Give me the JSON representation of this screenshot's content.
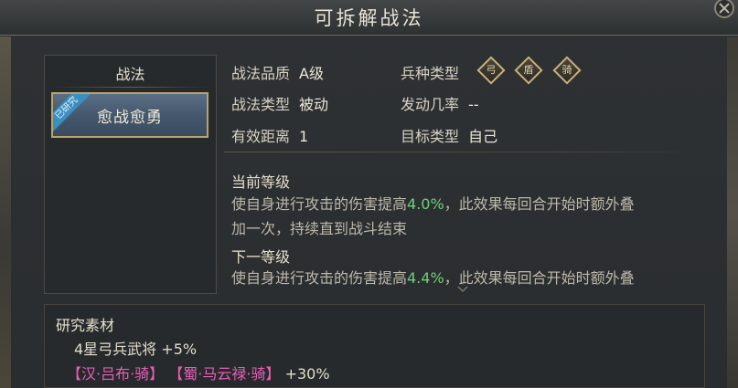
{
  "header": {
    "title": "可拆解战法"
  },
  "tactic_list": {
    "header": "战法",
    "items": [
      {
        "name": "愈战愈勇",
        "badge": "已研究"
      }
    ]
  },
  "attributes": {
    "quality": {
      "label": "战法品质",
      "value": "A级"
    },
    "type": {
      "label": "战法类型",
      "value": "被动"
    },
    "range": {
      "label": "有效距离",
      "value": "1"
    },
    "troops": {
      "label": "兵种类型",
      "icons": [
        "bow-troop-icon",
        "shield-troop-icon",
        "cavalry-troop-icon"
      ]
    },
    "trigger": {
      "label": "发动几率",
      "value": "--"
    },
    "target": {
      "label": "目标类型",
      "value": "自己"
    }
  },
  "current_level": {
    "title": "当前等级",
    "line1_pre": "使自身进行攻击的伤害提高",
    "line1_value": "4.0%",
    "line1_post": "，此效果每回合开始时额外叠",
    "line2": "加一次，持续直到战斗结束"
  },
  "next_level": {
    "title": "下一等级",
    "line1_pre": "使自身进行攻击的伤害提高",
    "line1_value": "4.4%",
    "line1_post": "，此效果每回合开始时额外叠"
  },
  "materials": {
    "title": "研究素材",
    "line1": {
      "text": "4星弓兵武将",
      "bonus": "+5%"
    },
    "line2": {
      "hero1": "【汉·吕布·骑】",
      "hero2": "【蜀·马云禄·骑】",
      "bonus": "+30%"
    }
  },
  "colors": {
    "highlight": "#6fd07a",
    "hero_name": "#e85fb8",
    "card_border": "#b9a46e",
    "badge": "#3a8ec0"
  }
}
